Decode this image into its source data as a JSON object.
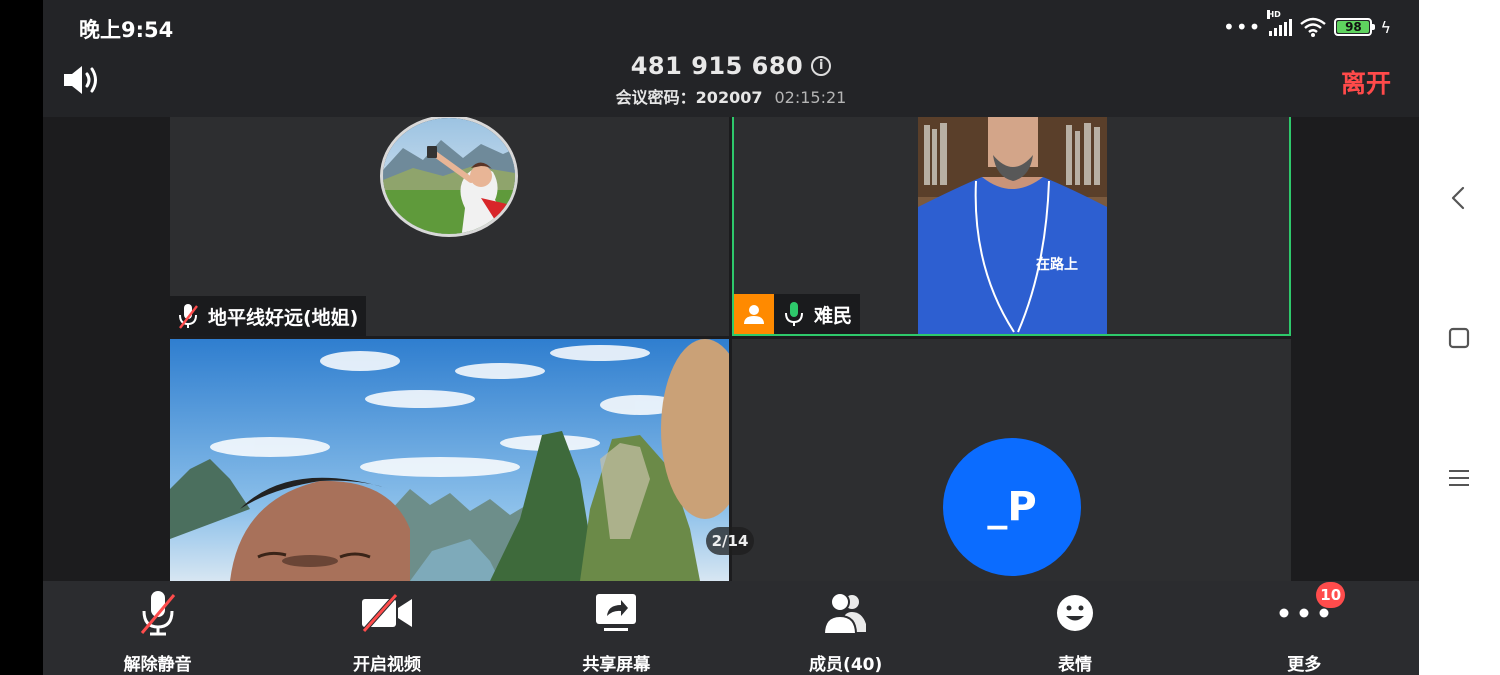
{
  "status_bar": {
    "time": "晚上9:54",
    "dots": "•••",
    "network_hd": "HD",
    "battery_level": "98",
    "battery_percent": 98
  },
  "header": {
    "meeting_id": "481 915 680",
    "password_label": "会议密码：",
    "password_value": "202007",
    "timer": "02:15:21",
    "leave_label": "离开"
  },
  "tiles": [
    {
      "name": "地平线好远(地姐)",
      "muted": true,
      "host": false
    },
    {
      "name": "难民",
      "muted": false,
      "host": true
    },
    {
      "name": "",
      "muted": false,
      "host": false
    },
    {
      "name": "",
      "avatar_initials": "_P",
      "avatar_color": "#0b6cff"
    }
  ],
  "grid": {
    "page_indicator": "2/14"
  },
  "toolbar": {
    "unmute_label": "解除静音",
    "start_video_label": "开启视频",
    "share_screen_label": "共享屏幕",
    "members_label": "成员(40)",
    "reactions_label": "表情",
    "more_label": "更多",
    "more_badge": "10"
  },
  "colors": {
    "leave": "#ff4a4a",
    "active_speaker_border": "#2ec96b",
    "host_badge": "#ff8a00",
    "mute_slash": "#ff4c4c",
    "badge": "#ff4c4c"
  }
}
